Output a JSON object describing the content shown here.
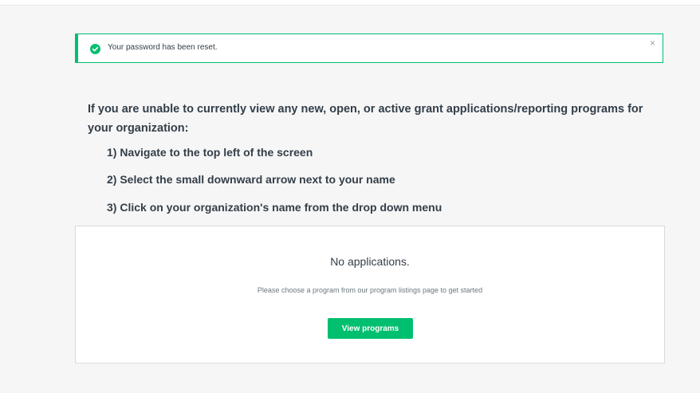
{
  "alert": {
    "message": "Your password has been reset.",
    "close_label": "×",
    "icon": "check-circle-icon",
    "color": "#00bf6f"
  },
  "instructions": {
    "lead": "If you are unable to currently view any new, open, or active grant applications/reporting programs for your organization:",
    "steps": [
      "1) Navigate to the top left of the screen",
      "2) Select the small downward arrow next to your name",
      "3) Click on your organization's name from the drop down menu"
    ]
  },
  "empty_state": {
    "title": "No applications.",
    "subtitle": "Please choose a program from our program listings page to get started",
    "button_label": "View programs"
  }
}
